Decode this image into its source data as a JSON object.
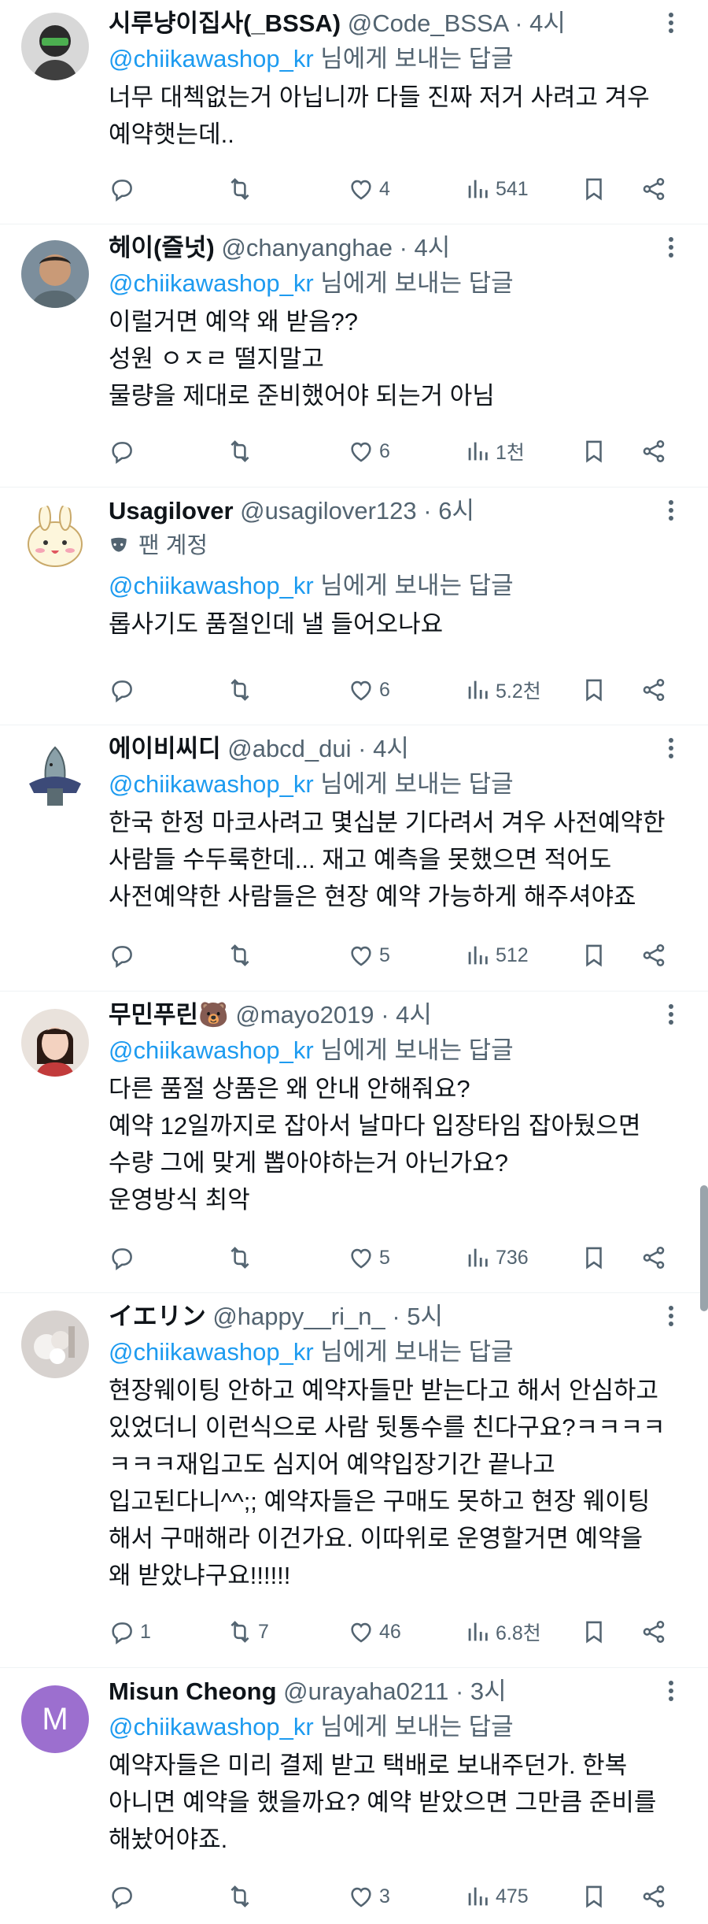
{
  "reply_prefix": "님에게 보내는 답글",
  "tweets": [
    {
      "name": "시루냥이집사(_BSSA)",
      "handle": "@Code_BSSA",
      "time": "· 4시",
      "mention": "@chiikawashop_kr",
      "text": "너무 대첵없는거 아닙니까 다들 진짜 저거 사려고 겨우\n예약햇는데..",
      "replies": "",
      "retweets": "",
      "likes": "4",
      "views": "541"
    },
    {
      "name": "헤이(즐넛)",
      "handle": "@chanyanghae",
      "time": "· 4시",
      "mention": "@chiikawashop_kr",
      "text": "이럴거면 예약 왜 받음??\n성원 ㅇㅈㄹ 떨지말고\n물량을 제대로 준비했어야 되는거 아님",
      "replies": "",
      "retweets": "",
      "likes": "6",
      "views": "1천"
    },
    {
      "name": "Usagilover",
      "handle": "@usagilover123",
      "time": "· 6시",
      "fan_label": "팬 계정",
      "mention": "@chiikawashop_kr",
      "text": "롭사기도 품절인데 낼 들어오나요",
      "replies": "",
      "retweets": "",
      "likes": "6",
      "views": "5.2천"
    },
    {
      "name": "에이비씨디",
      "handle": "@abcd_dui",
      "time": "· 4시",
      "mention": "@chiikawashop_kr",
      "text": "한국 한정 마코사려고 몇십분 기다려서 겨우 사전예약한\n사람들 수두룩한데... 재고 예측을 못했으면 적어도\n사전예약한 사람들은 현장 예약 가능하게 해주셔야죠",
      "replies": "",
      "retweets": "",
      "likes": "5",
      "views": "512"
    },
    {
      "name": "무민푸린🐻",
      "handle": "@mayo2019",
      "time": "· 4시",
      "mention": "@chiikawashop_kr",
      "text": "다른 품절 상품은 왜 안내 안해줘요?\n예약 12일까지로 잡아서 날마다 입장타임 잡아뒀으면\n수량 그에 맞게 뽑아야하는거 아닌가요?\n운영방식 최악",
      "replies": "",
      "retweets": "",
      "likes": "5",
      "views": "736"
    },
    {
      "name": "イエリン",
      "handle": "@happy__ri_n_",
      "time": "· 5시",
      "mention": "@chiikawashop_kr",
      "text": "현장웨이팅 안하고 예약자들만 받는다고 해서 안심하고\n있었더니 이런식으로 사람 뒷통수를 친다구요?ㅋㅋㅋㅋ\nㅋㅋㅋ재입고도 심지어 예약입장기간 끝나고\n입고된다니^^;; 예약자들은 구매도 못하고 현장 웨이팅\n해서 구매해라 이건가요. 이따위로 운영할거면 예약을\n왜 받았냐구요!!!!!!",
      "replies": "1",
      "retweets": "7",
      "likes": "46",
      "views": "6.8천"
    },
    {
      "name": "Misun Cheong",
      "handle": "@urayaha0211",
      "time": "· 3시",
      "avatar_letter": "M",
      "mention": "@chiikawashop_kr",
      "text": "예약자들은 미리 결제 받고 택배로 보내주던가. 한복\n아니면 예약을 했을까요? 예약 받았으면 그만큼 준비를\n해놨어야죠.",
      "replies": "",
      "retweets": "",
      "likes": "3",
      "views": "475"
    }
  ]
}
